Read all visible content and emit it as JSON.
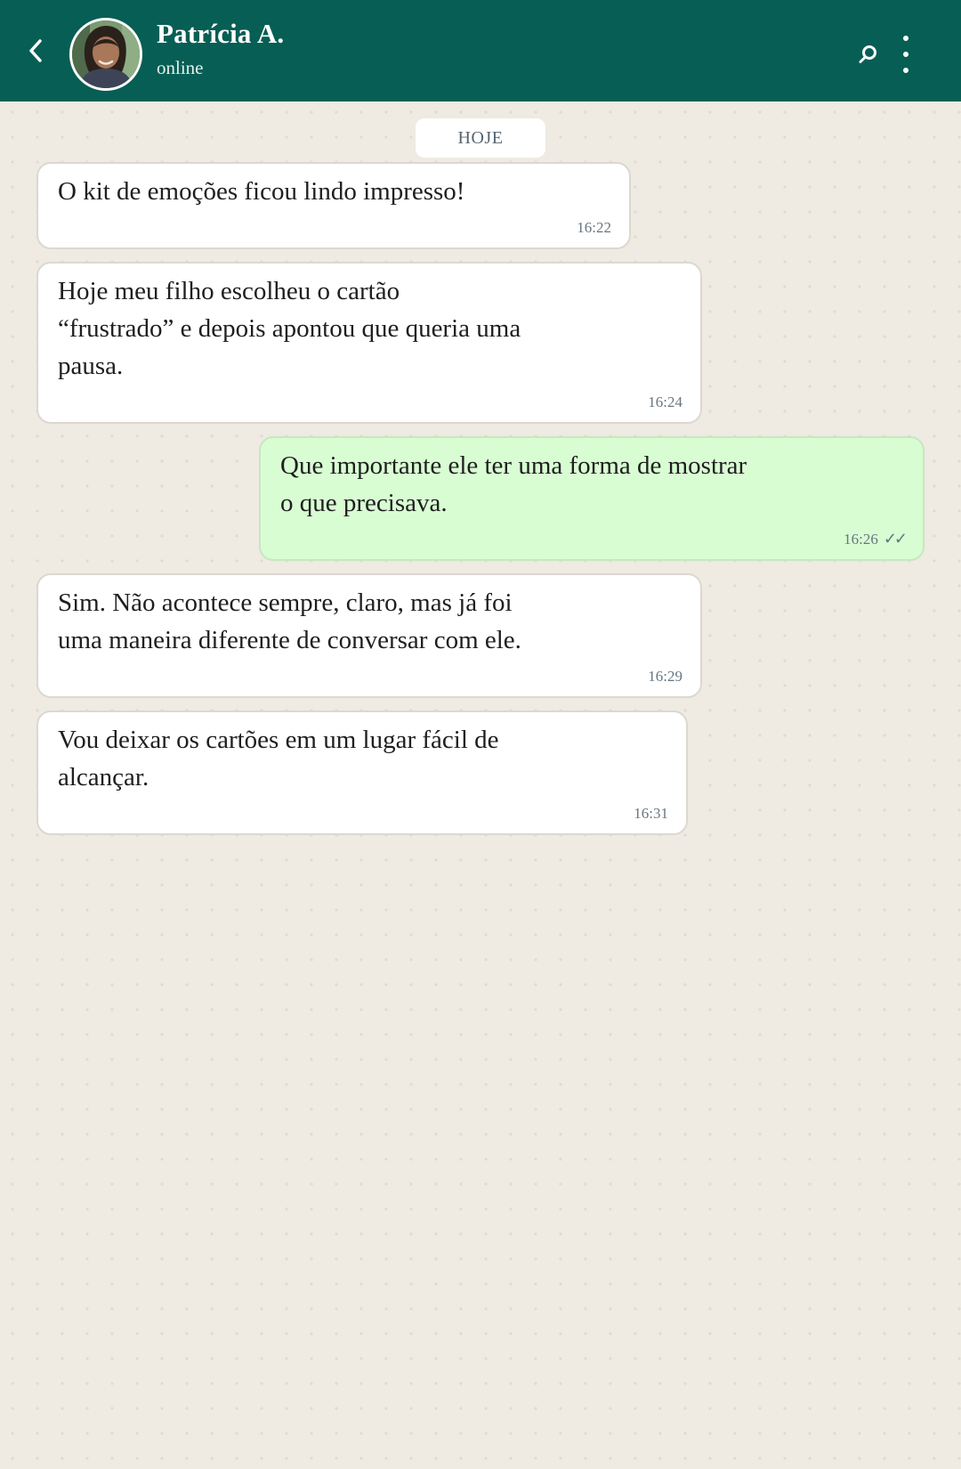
{
  "header": {
    "contact_name": "Patrícia A.",
    "contact_status": "online",
    "icons": {
      "back": "chevron-left-icon",
      "search": "search-icon",
      "menu": "more-vertical-icon"
    }
  },
  "date_chip": "HOJE",
  "messages": [
    {
      "direction": "in",
      "text": "O kit de emoções ficou lindo impresso!",
      "time": "16:22"
    },
    {
      "direction": "in",
      "text": "Hoje meu filho escolheu o cartão\n“frustrado” e depois apontou que queria uma\npausa.",
      "time": "16:24"
    },
    {
      "direction": "out",
      "text": "Que importante ele ter uma forma de mostrar\no que precisava.",
      "time": "16:26",
      "ticks": "✓✓"
    },
    {
      "direction": "in",
      "text": "Sim. Não acontece sempre, claro, mas já foi\numa maneira diferente de conversar com ele.",
      "time": "16:29"
    },
    {
      "direction": "in",
      "text": "Vou deixar os cartões em um lugar fácil de\nalcançar.",
      "time": "16:31"
    }
  ],
  "colors": {
    "header_bg": "#075e54",
    "chat_bg": "#efeae2",
    "incoming_bubble": "#ffffff",
    "outgoing_bubble": "#d9fdd3"
  }
}
